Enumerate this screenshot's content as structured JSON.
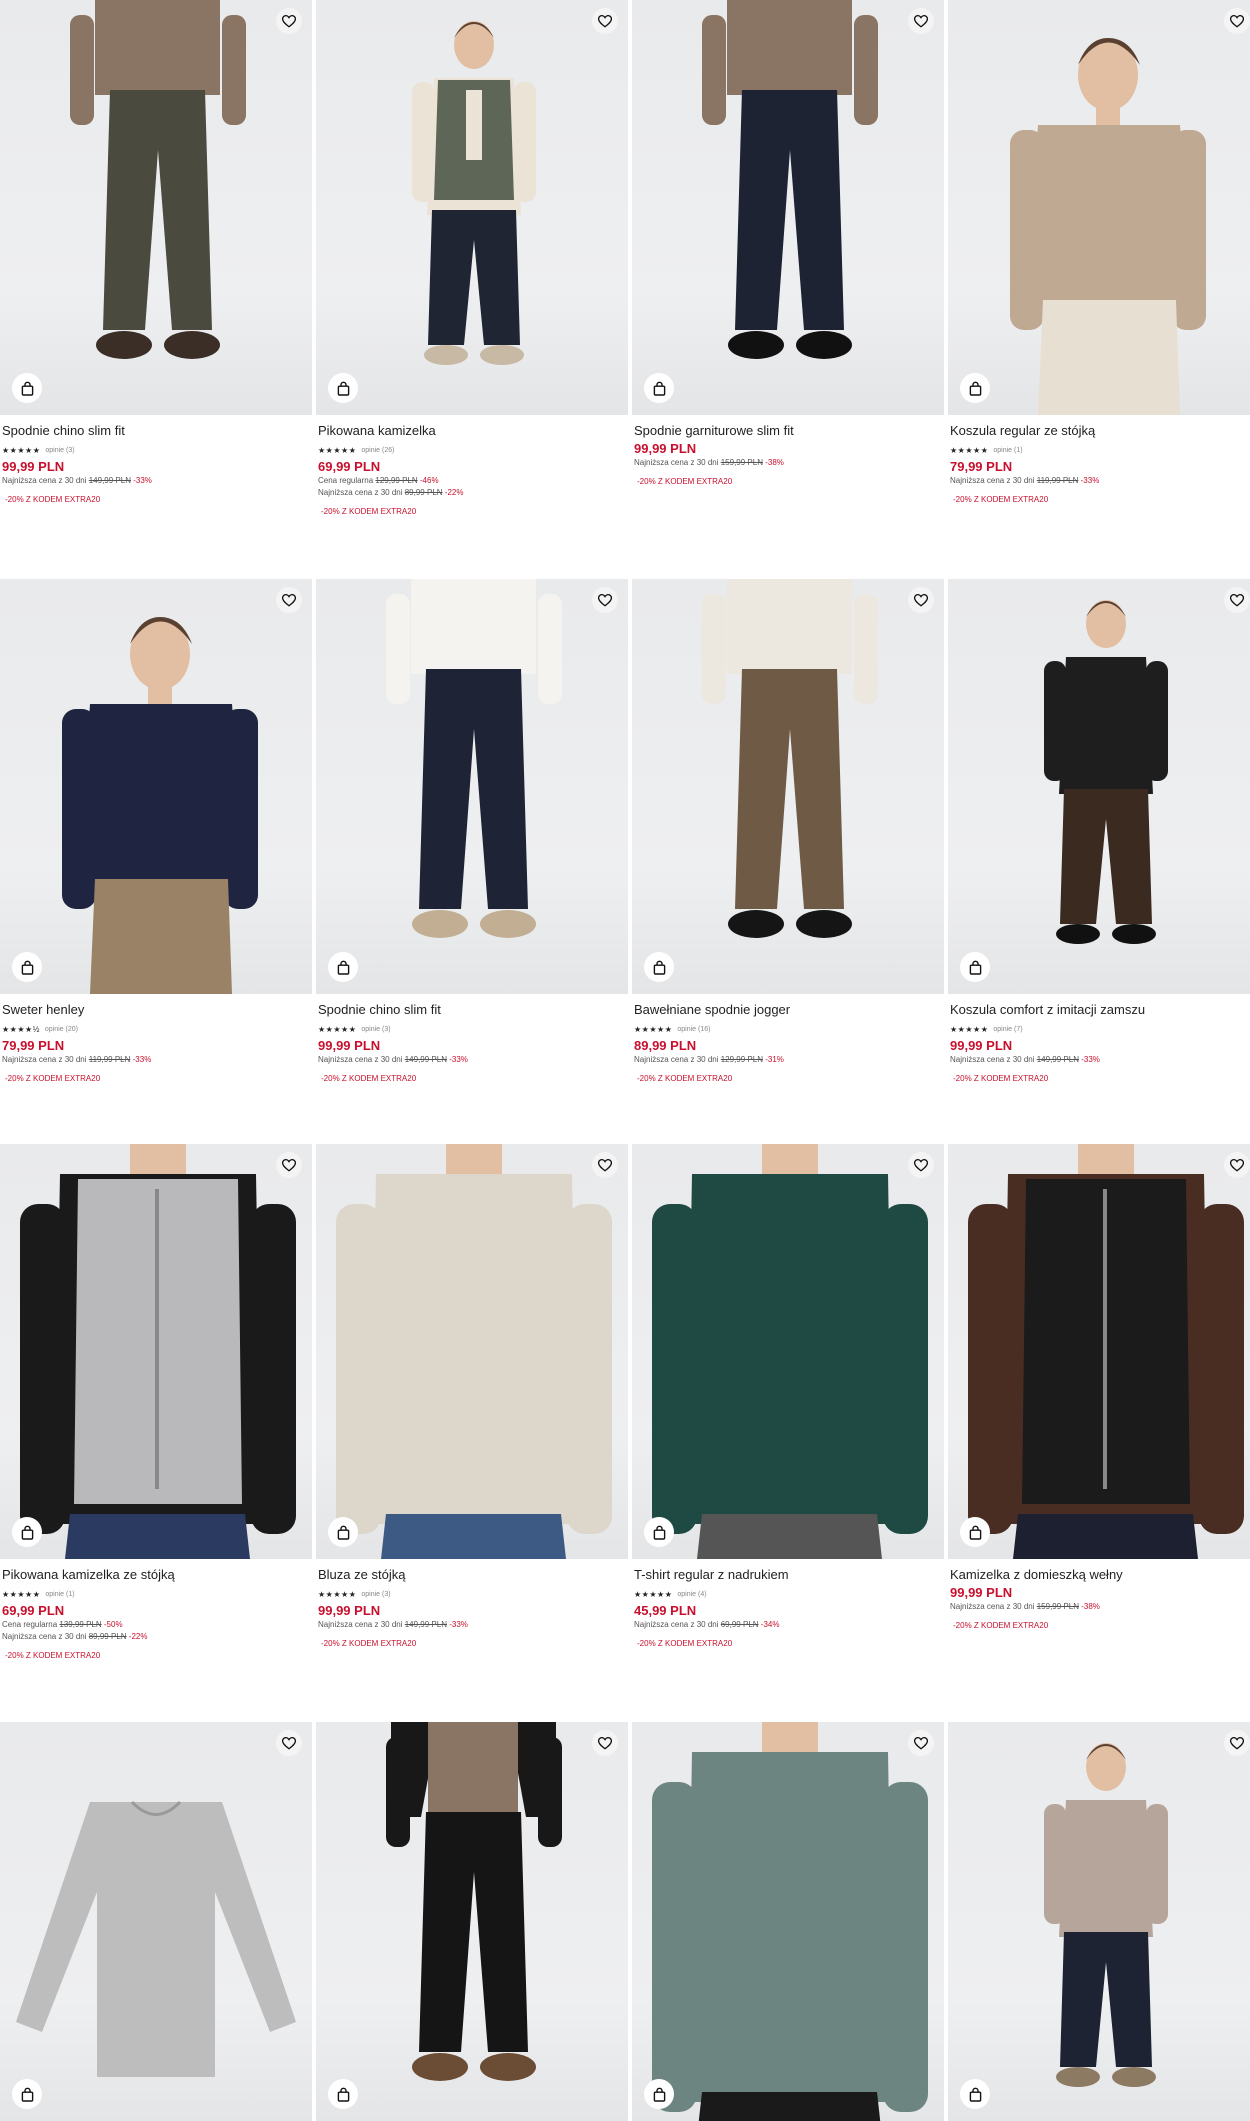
{
  "labels": {
    "lowest30": "Najniższa cena z 30 dni",
    "regular": "Cena regularna",
    "promo": "-20% Z KODEM EXTRA20"
  },
  "colors": {
    "price": "#c8102e",
    "background": "#ffffff",
    "photo_bg": "#ebecee"
  },
  "products": [
    {
      "title": "Spodnie chino slim fit",
      "stars": "★★★★★",
      "reviews": "opinie (3)",
      "price": "99,99 PLN",
      "regular_old": "",
      "regular_pct": "",
      "lowest_old": "149,99 PLN",
      "lowest_pct": "-33%",
      "garment": "chino-olive"
    },
    {
      "title": "Pikowana kamizelka",
      "stars": "★★★★★",
      "reviews": "opinie (26)",
      "price": "69,99 PLN",
      "regular_old": "129,99 PLN",
      "regular_pct": "-46%",
      "lowest_old": "89,99 PLN",
      "lowest_pct": "-22%",
      "garment": "vest-green"
    },
    {
      "title": "Spodnie garniturowe slim fit",
      "stars": "",
      "reviews": "",
      "price": "99,99 PLN",
      "regular_old": "",
      "regular_pct": "",
      "lowest_old": "159,99 PLN",
      "lowest_pct": "-38%",
      "garment": "suit-pants"
    },
    {
      "title": "Koszula regular ze stójką",
      "stars": "★★★★★",
      "reviews": "opinie (1)",
      "price": "79,99 PLN",
      "regular_old": "",
      "regular_pct": "",
      "lowest_old": "119,99 PLN",
      "lowest_pct": "-33%",
      "garment": "shirt-beige"
    },
    {
      "title": "Sweter henley",
      "stars": "★★★★½",
      "reviews": "opinie (20)",
      "price": "79,99 PLN",
      "regular_old": "",
      "regular_pct": "",
      "lowest_old": "119,99 PLN",
      "lowest_pct": "-33%",
      "garment": "henley-navy"
    },
    {
      "title": "Spodnie chino slim fit",
      "stars": "★★★★★",
      "reviews": "opinie (3)",
      "price": "99,99 PLN",
      "regular_old": "",
      "regular_pct": "",
      "lowest_old": "149,99 PLN",
      "lowest_pct": "-33%",
      "garment": "chino-navy"
    },
    {
      "title": "Bawełniane spodnie jogger",
      "stars": "★★★★★",
      "reviews": "opinie (16)",
      "price": "89,99 PLN",
      "regular_old": "",
      "regular_pct": "",
      "lowest_old": "129,99 PLN",
      "lowest_pct": "-31%",
      "garment": "jogger-brown"
    },
    {
      "title": "Koszula comfort z imitacji zamszu",
      "stars": "★★★★★",
      "reviews": "opinie (7)",
      "price": "99,99 PLN",
      "regular_old": "",
      "regular_pct": "",
      "lowest_old": "149,99 PLN",
      "lowest_pct": "-33%",
      "garment": "overshirt-black"
    },
    {
      "title": "Pikowana kamizelka ze stójką",
      "stars": "★★★★★",
      "reviews": "opinie (1)",
      "price": "69,99 PLN",
      "regular_old": "139,99 PLN",
      "regular_pct": "-50%",
      "lowest_old": "89,99 PLN",
      "lowest_pct": "-22%",
      "garment": "vest-grey"
    },
    {
      "title": "Bluza ze stójką",
      "stars": "★★★★★",
      "reviews": "opinie (3)",
      "price": "99,99 PLN",
      "regular_old": "",
      "regular_pct": "",
      "lowest_old": "149,99 PLN",
      "lowest_pct": "-33%",
      "garment": "zip-cream"
    },
    {
      "title": "T-shirt regular z nadrukiem",
      "stars": "★★★★★",
      "reviews": "opinie (4)",
      "price": "45,99 PLN",
      "regular_old": "",
      "regular_pct": "",
      "lowest_old": "69,99 PLN",
      "lowest_pct": "-34%",
      "garment": "tee-green"
    },
    {
      "title": "Kamizelka z domieszką wełny",
      "stars": "",
      "reviews": "",
      "price": "99,99 PLN",
      "regular_old": "",
      "regular_pct": "",
      "lowest_old": "159,99 PLN",
      "lowest_pct": "-38%",
      "garment": "vest-black"
    },
    {
      "title": "",
      "stars": "",
      "reviews": "",
      "price": "",
      "regular_old": "",
      "regular_pct": "",
      "lowest_old": "",
      "lowest_pct": "",
      "garment": "longsleeve-grey"
    },
    {
      "title": "",
      "stars": "",
      "reviews": "",
      "price": "",
      "regular_old": "",
      "regular_pct": "",
      "lowest_old": "",
      "lowest_pct": "",
      "garment": "jogger-black"
    },
    {
      "title": "",
      "stars": "",
      "reviews": "",
      "price": "",
      "regular_old": "",
      "regular_pct": "",
      "lowest_old": "",
      "lowest_pct": "",
      "garment": "shirt-sage"
    },
    {
      "title": "",
      "stars": "",
      "reviews": "",
      "price": "",
      "regular_old": "",
      "regular_pct": "",
      "lowest_old": "",
      "lowest_pct": "",
      "garment": "jacket-taupe"
    }
  ]
}
